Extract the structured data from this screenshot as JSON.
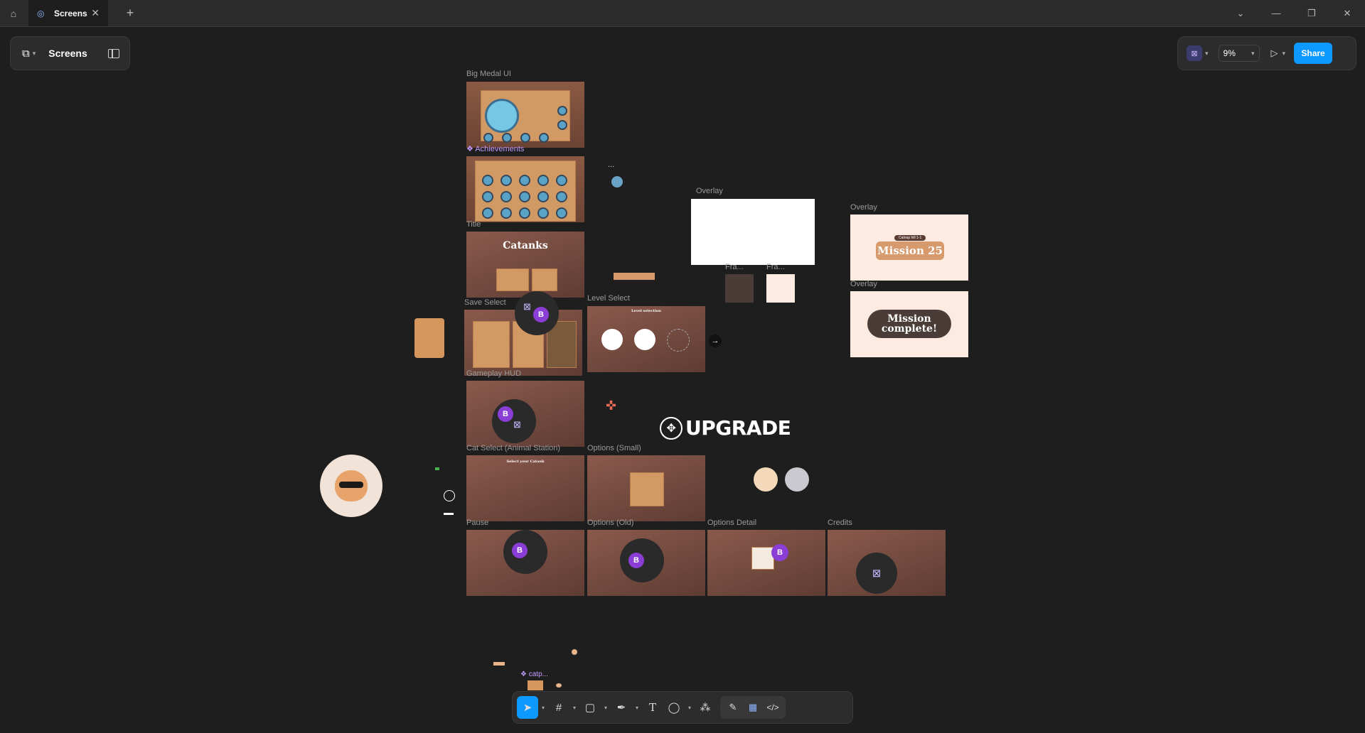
{
  "titlebar": {
    "tab_label": "Screens",
    "new_tab": "+"
  },
  "file": {
    "name": "Screens"
  },
  "viewer": {
    "zoom": "9%",
    "share_label": "Share",
    "avatar_badge": "B"
  },
  "frames": {
    "big_medal": "Big Medal UI",
    "achievements": "Achievements",
    "title": "Title",
    "title_heading": "Catanks",
    "save_select": "Save Select",
    "level_select": "Level Select",
    "level_select_heading": "Level selection",
    "gameplay_hud": "Gameplay HUD",
    "cat_select": "Cat Select (Animal Station)",
    "cat_select_heading": "Select your Catank",
    "options_small": "Options (Small)",
    "pause": "Pause",
    "options_old": "Options (Old)",
    "options_detail": "Options Detail",
    "credits": "Credits",
    "overlay_1": "Overlay",
    "overlay_2": "Overlay",
    "overlay_3": "Overlay",
    "frame_a": "Fra...",
    "frame_b": "Fra...",
    "mission25": "Mission 25",
    "mission25_tag": "Catnap hill 1-1",
    "mission_complete": "Mission complete!",
    "upgrade": "UPGRADE",
    "catp": "catp...",
    "ellipsis": "..."
  },
  "toolbar": {
    "tools": [
      "move-tool",
      "frame-tool",
      "shape-tool",
      "pen-tool",
      "text-tool",
      "comment-tool",
      "actions-tool"
    ],
    "modes": [
      "draw-mode",
      "design-mode",
      "dev-mode"
    ]
  }
}
